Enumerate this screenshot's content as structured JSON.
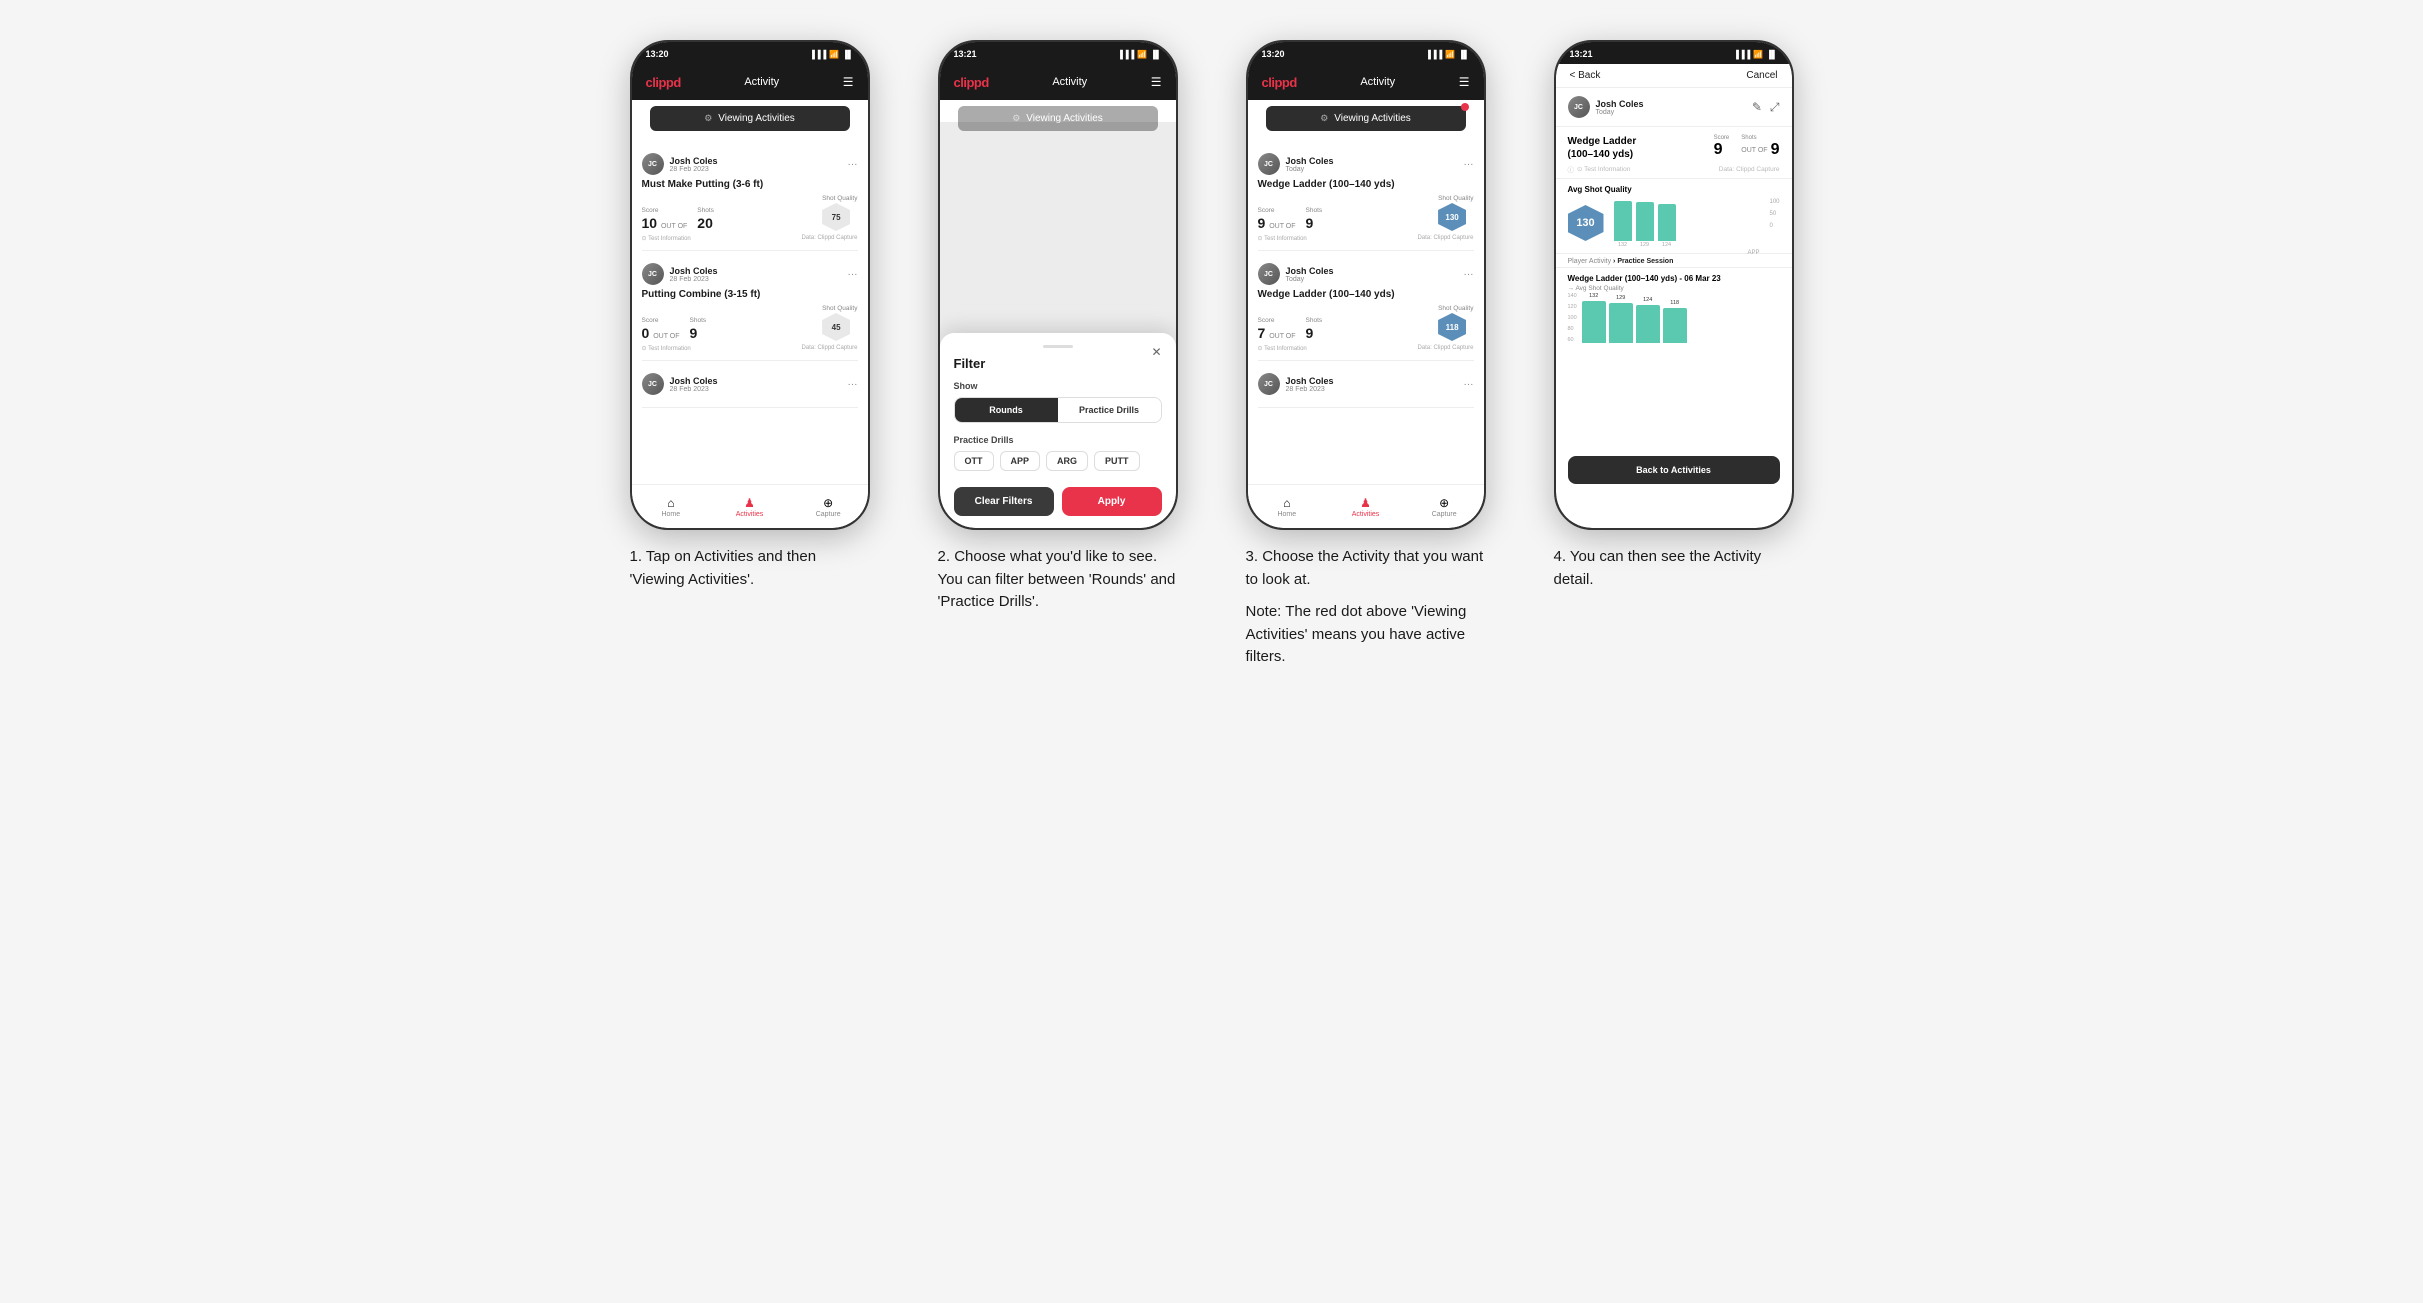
{
  "phones": [
    {
      "id": "phone1",
      "time": "13:20",
      "nav": {
        "logo": "clippd",
        "title": "Activity",
        "menu": "☰"
      },
      "viewingBar": {
        "icon": "⚙",
        "label": "Viewing Activities",
        "hasDot": false
      },
      "cards": [
        {
          "userName": "Josh Coles",
          "userDate": "28 Feb 2023",
          "title": "Must Make Putting (3-6 ft)",
          "scoreLabel": "Score",
          "shotsLabel": "Shots",
          "qualityLabel": "Shot Quality",
          "score": "10",
          "outOf": "OUT OF",
          "shots": "20",
          "quality": "75",
          "qualityBlue": false,
          "footerLeft": "⊙ Test Information",
          "footerRight": "Data: Clippd Capture"
        },
        {
          "userName": "Josh Coles",
          "userDate": "28 Feb 2023",
          "title": "Putting Combine (3-15 ft)",
          "scoreLabel": "Score",
          "shotsLabel": "Shots",
          "qualityLabel": "Shot Quality",
          "score": "0",
          "outOf": "OUT OF",
          "shots": "9",
          "quality": "45",
          "qualityBlue": false,
          "footerLeft": "⊙ Test Information",
          "footerRight": "Data: Clippd Capture"
        },
        {
          "userName": "Josh Coles",
          "userDate": "28 Feb 2023",
          "title": "",
          "scoreLabel": "",
          "shotsLabel": "",
          "qualityLabel": "",
          "score": "",
          "outOf": "",
          "shots": "",
          "quality": "",
          "qualityBlue": false,
          "footerLeft": "",
          "footerRight": ""
        }
      ],
      "tabs": [
        {
          "label": "Home",
          "icon": "⌂",
          "active": false
        },
        {
          "label": "Activities",
          "icon": "♟",
          "active": true
        },
        {
          "label": "Capture",
          "icon": "+",
          "active": false
        }
      ]
    },
    {
      "id": "phone2",
      "time": "13:21",
      "nav": {
        "logo": "clippd",
        "title": "Activity",
        "menu": "☰"
      },
      "viewingBar": {
        "icon": "⚙",
        "label": "Viewing Activities",
        "hasDot": false
      },
      "filter": {
        "title": "Filter",
        "showLabel": "Show",
        "roundsLabel": "Rounds",
        "practiceLabel": "Practice Drills",
        "practiceSection": "Practice Drills",
        "chips": [
          "OTT",
          "APP",
          "ARG",
          "PUTT"
        ],
        "clearBtn": "Clear Filters",
        "applyBtn": "Apply"
      },
      "tabs": [
        {
          "label": "Home",
          "icon": "⌂",
          "active": false
        },
        {
          "label": "Activities",
          "icon": "♟",
          "active": true
        },
        {
          "label": "Capture",
          "icon": "+",
          "active": false
        }
      ]
    },
    {
      "id": "phone3",
      "time": "13:20",
      "nav": {
        "logo": "clippd",
        "title": "Activity",
        "menu": "☰"
      },
      "viewingBar": {
        "icon": "⚙",
        "label": "Viewing Activities",
        "hasDot": true
      },
      "cards": [
        {
          "userName": "Josh Coles",
          "userDate": "Today",
          "title": "Wedge Ladder (100–140 yds)",
          "scoreLabel": "Score",
          "shotsLabel": "Shots",
          "qualityLabel": "Shot Quality",
          "score": "9",
          "outOf": "OUT OF",
          "shots": "9",
          "quality": "130",
          "qualityBlue": true,
          "footerLeft": "⊙ Test Information",
          "footerRight": "Data: Clippd Capture"
        },
        {
          "userName": "Josh Coles",
          "userDate": "Today",
          "title": "Wedge Ladder (100–140 yds)",
          "scoreLabel": "Score",
          "shotsLabel": "Shots",
          "qualityLabel": "Shot Quality",
          "score": "7",
          "outOf": "OUT OF",
          "shots": "9",
          "quality": "118",
          "qualityBlue": true,
          "footerLeft": "⊙ Test Information",
          "footerRight": "Data: Clippd Capture"
        },
        {
          "userName": "Josh Coles",
          "userDate": "28 Feb 2023",
          "title": "",
          "scoreLabel": "",
          "shotsLabel": "",
          "qualityLabel": "",
          "score": "",
          "outOf": "",
          "shots": "",
          "quality": "",
          "qualityBlue": false,
          "footerLeft": "",
          "footerRight": ""
        }
      ],
      "tabs": [
        {
          "label": "Home",
          "icon": "⌂",
          "active": false
        },
        {
          "label": "Activities",
          "icon": "♟",
          "active": true
        },
        {
          "label": "Capture",
          "icon": "+",
          "active": false
        }
      ]
    },
    {
      "id": "phone4",
      "time": "13:21",
      "back": "< Back",
      "cancel": "Cancel",
      "userName": "Josh Coles",
      "userDate": "Today",
      "activityTitle": "Wedge Ladder\n(100–140 yds)",
      "scoreLabel": "Score",
      "shotsLabel": "Shots",
      "score": "9",
      "shots": "9",
      "outOf": "OUT OF",
      "avgQualityLabel": "Avg Shot Quality",
      "qualityValue": "130",
      "chartBars": [
        132,
        129,
        124
      ],
      "chartLabel": "APP",
      "playerActivityLabel": "Player Activity",
      "practiceSession": "Practice Session",
      "sessionTitle": "Wedge Ladder (100–140 yds) - 06 Mar 23",
      "sessionSubtitle": "→ Avg Shot Quality",
      "bars2": [
        132,
        129,
        124,
        118
      ],
      "backToActivities": "Back to Activities",
      "infoLabel": "⊙ Test Information",
      "captureLabel": "Data: Clippd Capture"
    }
  ],
  "steps": [
    {
      "number": "1.",
      "text": "Tap on Activities and then 'Viewing Activities'."
    },
    {
      "number": "2.",
      "text": "Choose what you'd like to see. You can filter between 'Rounds' and 'Practice Drills'."
    },
    {
      "number": "3.",
      "text": "Choose the Activity that you want to look at.",
      "note": "Note: The red dot above 'Viewing Activities' means you have active filters."
    },
    {
      "number": "4.",
      "text": "You can then see the Activity detail."
    }
  ]
}
